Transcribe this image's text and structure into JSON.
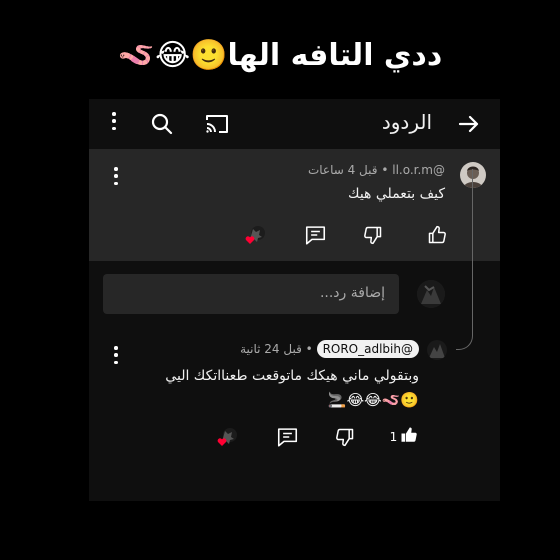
{
  "caption": "ددي التافه الها🙂😂🪱",
  "header": {
    "title": "الردود",
    "back_icon": "arrow-right-icon",
    "cast_icon": "cast-icon",
    "search_icon": "search-icon",
    "more_icon": "more-vert-icon"
  },
  "comments": [
    {
      "author": "@ll.o.r.m",
      "time": "قبل 4 ساعات",
      "text": "كيف بتعملي هيك",
      "like_count": ""
    },
    {
      "author": "@RORO_adlbih",
      "time": "قبل 24 ثانية",
      "line1": "وبتقولي ماني هيكك ماتوقعت طعنااتكك اليي",
      "line2": "🙂🪱😂😂🚬",
      "like_count": "1"
    }
  ],
  "reply_input": {
    "placeholder": "إضافة رد..."
  },
  "colors": {
    "panel": "#0f0f0f",
    "highlight": "#272727",
    "heart": "#ff0033"
  }
}
